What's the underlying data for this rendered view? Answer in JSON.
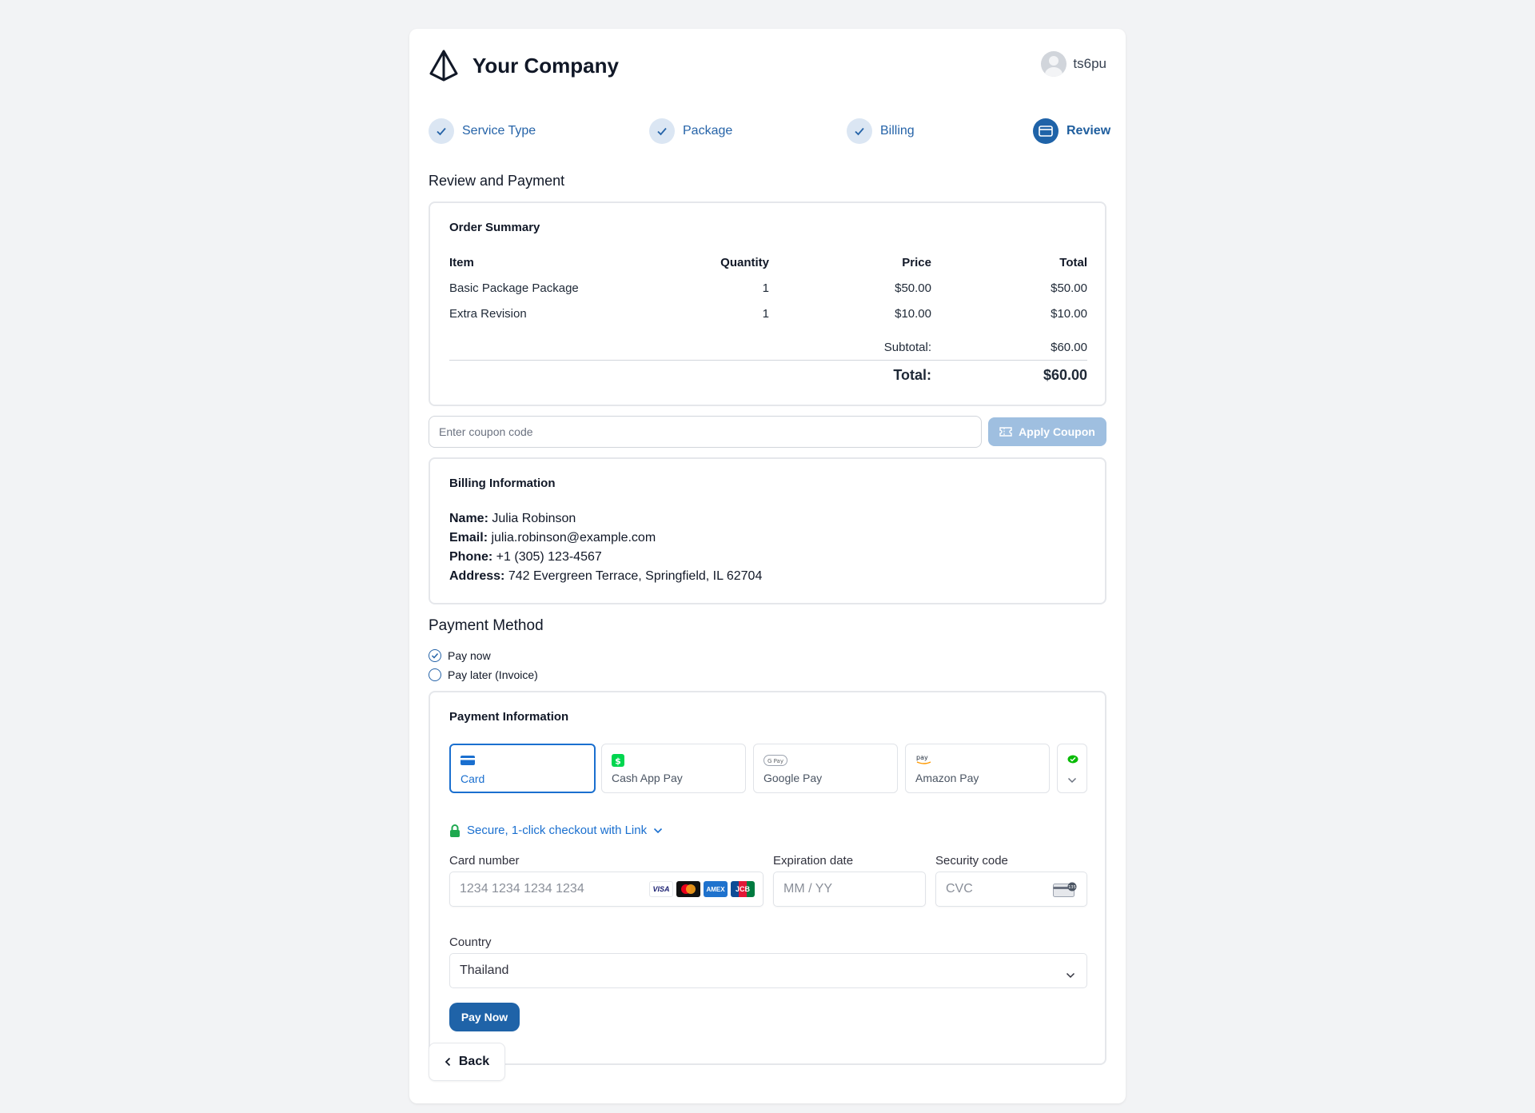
{
  "header": {
    "brand": "Your Company",
    "username": "ts6pu"
  },
  "steps": [
    {
      "label": "Service Type",
      "state": "done"
    },
    {
      "label": "Package",
      "state": "done"
    },
    {
      "label": "Billing",
      "state": "done"
    },
    {
      "label": "Review",
      "state": "active"
    }
  ],
  "page_title": "Review and Payment",
  "order_summary": {
    "title": "Order Summary",
    "columns": [
      "Item",
      "Quantity",
      "Price",
      "Total"
    ],
    "rows": [
      {
        "item": "Basic Package Package",
        "quantity": "1",
        "price": "$50.00",
        "total": "$50.00"
      },
      {
        "item": "Extra Revision",
        "quantity": "1",
        "price": "$10.00",
        "total": "$10.00"
      }
    ],
    "subtotal_label": "Subtotal:",
    "subtotal_value": "$60.00",
    "total_label": "Total:",
    "total_value": "$60.00"
  },
  "coupon": {
    "placeholder": "Enter coupon code",
    "button_label": "Apply Coupon"
  },
  "billing": {
    "title": "Billing Information",
    "name_label": "Name:",
    "name": "Julia Robinson",
    "email_label": "Email:",
    "email": "julia.robinson@example.com",
    "phone_label": "Phone:",
    "phone": "+1 (305) 123-4567",
    "address_label": "Address:",
    "address": "742 Evergreen Terrace, Springfield, IL 62704"
  },
  "payment_method": {
    "title": "Payment Method",
    "options": [
      {
        "label": "Pay now",
        "selected": true
      },
      {
        "label": "Pay later (Invoice)",
        "selected": false
      }
    ]
  },
  "payment_info": {
    "title": "Payment Information",
    "tabs": [
      {
        "label": "Card",
        "icon": "card-icon",
        "selected": true
      },
      {
        "label": "Cash App Pay",
        "icon": "cash-app-icon",
        "selected": false
      },
      {
        "label": "Google Pay",
        "icon": "google-pay-icon",
        "selected": false
      },
      {
        "label": "Amazon Pay",
        "icon": "amazon-pay-icon",
        "selected": false
      }
    ],
    "link_text": "Secure, 1-click checkout with Link",
    "card_number_label": "Card number",
    "card_number_placeholder": "1234 1234 1234 1234",
    "expiry_label": "Expiration date",
    "expiry_placeholder": "MM / YY",
    "cvc_label": "Security code",
    "cvc_placeholder": "CVC",
    "country_label": "Country",
    "country_value": "Thailand",
    "pay_button": "Pay Now",
    "card_brands": [
      "VISA",
      "mastercard",
      "AMEX",
      "JCB"
    ]
  },
  "back_button": "Back",
  "colors": {
    "primary": "#1f63a8",
    "accent_blue": "#1a6fcf",
    "link_green": "#1a8f4f",
    "page_bg": "#f2f3f5"
  }
}
